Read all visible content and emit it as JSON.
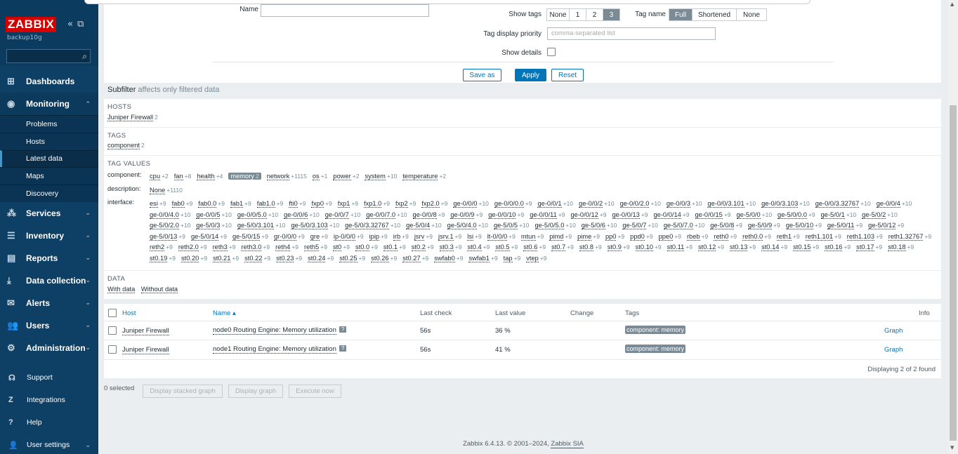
{
  "app": {
    "logo": "ZABBIX",
    "server": "backup10g"
  },
  "sidebar": {
    "menu": [
      {
        "label": "Dashboards",
        "icon": "dashboard-icon"
      },
      {
        "label": "Monitoring",
        "icon": "eye-icon",
        "open": true
      },
      {
        "label": "Services",
        "icon": "services-icon"
      },
      {
        "label": "Inventory",
        "icon": "list-icon"
      },
      {
        "label": "Reports",
        "icon": "report-icon"
      },
      {
        "label": "Data collection",
        "icon": "download-icon"
      },
      {
        "label": "Alerts",
        "icon": "mail-icon"
      },
      {
        "label": "Users",
        "icon": "users-icon"
      },
      {
        "label": "Administration",
        "icon": "gear-icon"
      }
    ],
    "monitoring_sub": [
      "Problems",
      "Hosts",
      "Latest data",
      "Maps",
      "Discovery"
    ],
    "bottom": [
      {
        "label": "Support",
        "icon": "support-icon"
      },
      {
        "label": "Integrations",
        "icon": "integrations-icon"
      },
      {
        "label": "Help",
        "icon": "help-icon"
      },
      {
        "label": "User settings",
        "icon": "user-icon"
      }
    ]
  },
  "filter": {
    "name_label": "Name",
    "show_tags_label": "Show tags",
    "show_tags_options": [
      "None",
      "1",
      "2",
      "3"
    ],
    "tag_name_label": "Tag name",
    "tag_name_options": [
      "Full",
      "Shortened",
      "None"
    ],
    "tag_priority_label": "Tag display priority",
    "tag_priority_placeholder": "comma-separated list",
    "show_details_label": "Show details",
    "save_as": "Save as",
    "apply": "Apply",
    "reset": "Reset"
  },
  "subfilter": {
    "title": "Subfilter",
    "note": "affects only filtered data",
    "hosts_header": "HOSTS",
    "hosts": [
      {
        "name": "Juniper Firewall",
        "count": "2"
      }
    ],
    "tags_header": "TAGS",
    "tags": [
      {
        "name": "component",
        "count": "2"
      }
    ],
    "tag_values_header": "TAG VALUES",
    "component_label": "component:",
    "component": [
      [
        "cpu",
        "+2"
      ],
      [
        "fan",
        "+8"
      ],
      [
        "health",
        "+4"
      ],
      [
        "memory",
        "2"
      ],
      [
        "network",
        "+1115"
      ],
      [
        "os",
        "+1"
      ],
      [
        "power",
        "+2"
      ],
      [
        "system",
        "+10"
      ],
      [
        "temperature",
        "+2"
      ]
    ],
    "description_label": "description:",
    "description": [
      [
        "None",
        "+1110"
      ]
    ],
    "interface_label": "interface:",
    "interface": [
      [
        "esi",
        "+9"
      ],
      [
        "fab0",
        "+9"
      ],
      [
        "fab0.0",
        "+9"
      ],
      [
        "fab1",
        "+9"
      ],
      [
        "fab1.0",
        "+9"
      ],
      [
        "fti0",
        "+9"
      ],
      [
        "fxp0",
        "+9"
      ],
      [
        "fxp1",
        "+9"
      ],
      [
        "fxp1.0",
        "+9"
      ],
      [
        "fxp2",
        "+9"
      ],
      [
        "fxp2.0",
        "+9"
      ],
      [
        "ge-0/0/0",
        "+10"
      ],
      [
        "ge-0/0/0.0",
        "+9"
      ],
      [
        "ge-0/0/1",
        "+10"
      ],
      [
        "ge-0/0/2",
        "+10"
      ],
      [
        "ge-0/0/2.0",
        "+10"
      ],
      [
        "ge-0/0/3",
        "+10"
      ],
      [
        "ge-0/0/3.101",
        "+10"
      ],
      [
        "ge-0/0/3.103",
        "+10"
      ],
      [
        "ge-0/0/3.32767",
        "+10"
      ],
      [
        "ge-0/0/4",
        "+10"
      ],
      [
        "ge-0/0/4.0",
        "+10"
      ],
      [
        "ge-0/0/5",
        "+10"
      ],
      [
        "ge-0/0/5.0",
        "+10"
      ],
      [
        "ge-0/0/6",
        "+10"
      ],
      [
        "ge-0/0/7",
        "+10"
      ],
      [
        "ge-0/0/7.0",
        "+10"
      ],
      [
        "ge-0/0/8",
        "+9"
      ],
      [
        "ge-0/0/9",
        "+9"
      ],
      [
        "ge-0/0/10",
        "+9"
      ],
      [
        "ge-0/0/11",
        "+9"
      ],
      [
        "ge-0/0/12",
        "+9"
      ],
      [
        "ge-0/0/13",
        "+9"
      ],
      [
        "ge-0/0/14",
        "+9"
      ],
      [
        "ge-0/0/15",
        "+9"
      ],
      [
        "ge-5/0/0",
        "+10"
      ],
      [
        "ge-5/0/0.0",
        "+9"
      ],
      [
        "ge-5/0/1",
        "+10"
      ],
      [
        "ge-5/0/2",
        "+10"
      ],
      [
        "ge-5/0/2.0",
        "+10"
      ],
      [
        "ge-5/0/3",
        "+10"
      ],
      [
        "ge-5/0/3.101",
        "+10"
      ],
      [
        "ge-5/0/3.103",
        "+10"
      ],
      [
        "ge-5/0/3.32767",
        "+10"
      ],
      [
        "ge-5/0/4",
        "+10"
      ],
      [
        "ge-5/0/4.0",
        "+10"
      ],
      [
        "ge-5/0/5",
        "+10"
      ],
      [
        "ge-5/0/5.0",
        "+10"
      ],
      [
        "ge-5/0/6",
        "+10"
      ],
      [
        "ge-5/0/7",
        "+10"
      ],
      [
        "ge-5/0/7.0",
        "+10"
      ],
      [
        "ge-5/0/8",
        "+9"
      ],
      [
        "ge-5/0/9",
        "+9"
      ],
      [
        "ge-5/0/10",
        "+9"
      ],
      [
        "ge-5/0/11",
        "+9"
      ],
      [
        "ge-5/0/12",
        "+9"
      ],
      [
        "ge-5/0/13",
        "+9"
      ],
      [
        "ge-5/0/14",
        "+9"
      ],
      [
        "ge-5/0/15",
        "+9"
      ],
      [
        "gr-0/0/0",
        "+9"
      ],
      [
        "gre",
        "+9"
      ],
      [
        "ip-0/0/0",
        "+9"
      ],
      [
        "ipip",
        "+9"
      ],
      [
        "irb",
        "+9"
      ],
      [
        "jsrv",
        "+9"
      ],
      [
        "jsrv.1",
        "+9"
      ],
      [
        "lsi",
        "+9"
      ],
      [
        "lt-0/0/0",
        "+9"
      ],
      [
        "mtun",
        "+9"
      ],
      [
        "pimd",
        "+9"
      ],
      [
        "pime",
        "+9"
      ],
      [
        "pp0",
        "+9"
      ],
      [
        "ppd0",
        "+9"
      ],
      [
        "ppe0",
        "+9"
      ],
      [
        "rbeb",
        "+9"
      ],
      [
        "reth0",
        "+9"
      ],
      [
        "reth0.0",
        "+9"
      ],
      [
        "reth1",
        "+9"
      ],
      [
        "reth1.101",
        "+9"
      ],
      [
        "reth1.103",
        "+9"
      ],
      [
        "reth1.32767",
        "+9"
      ],
      [
        "reth2",
        "+9"
      ],
      [
        "reth2.0",
        "+9"
      ],
      [
        "reth3",
        "+9"
      ],
      [
        "reth3.0",
        "+9"
      ],
      [
        "reth4",
        "+9"
      ],
      [
        "reth5",
        "+9"
      ],
      [
        "st0",
        "+9"
      ],
      [
        "st0.0",
        "+9"
      ],
      [
        "st0.1",
        "+9"
      ],
      [
        "st0.2",
        "+9"
      ],
      [
        "st0.3",
        "+9"
      ],
      [
        "st0.4",
        "+9"
      ],
      [
        "st0.5",
        "+9"
      ],
      [
        "st0.6",
        "+9"
      ],
      [
        "st0.7",
        "+9"
      ],
      [
        "st0.8",
        "+9"
      ],
      [
        "st0.9",
        "+9"
      ],
      [
        "st0.10",
        "+9"
      ],
      [
        "st0.11",
        "+9"
      ],
      [
        "st0.12",
        "+9"
      ],
      [
        "st0.13",
        "+9"
      ],
      [
        "st0.14",
        "+9"
      ],
      [
        "st0.15",
        "+9"
      ],
      [
        "st0.16",
        "+9"
      ],
      [
        "st0.17",
        "+9"
      ],
      [
        "st0.18",
        "+9"
      ],
      [
        "st0.19",
        "+9"
      ],
      [
        "st0.20",
        "+9"
      ],
      [
        "st0.21",
        "+9"
      ],
      [
        "st0.22",
        "+9"
      ],
      [
        "st0.23",
        "+9"
      ],
      [
        "st0.24",
        "+9"
      ],
      [
        "st0.25",
        "+9"
      ],
      [
        "st0.26",
        "+9"
      ],
      [
        "st0.27",
        "+9"
      ],
      [
        "swfab0",
        "+9"
      ],
      [
        "swfab1",
        "+9"
      ],
      [
        "tap",
        "+9"
      ],
      [
        "vtep",
        "+9"
      ]
    ],
    "data_header": "DATA",
    "data": [
      "With data",
      "Without data"
    ]
  },
  "table": {
    "headers": {
      "host": "Host",
      "name": "Name ▴",
      "last_check": "Last check",
      "last_value": "Last value",
      "change": "Change",
      "tags": "Tags",
      "info": "Info"
    },
    "rows": [
      {
        "host": "Juniper Firewall",
        "name": "node0 Routing Engine: Memory utilization",
        "badge": "?",
        "last_check": "56s",
        "last_value": "36 %",
        "change": "",
        "tag": "component: memory",
        "action": "Graph"
      },
      {
        "host": "Juniper Firewall",
        "name": "node1 Routing Engine: Memory utilization",
        "badge": "?",
        "last_check": "56s",
        "last_value": "41 %",
        "change": "",
        "tag": "component: memory",
        "action": "Graph"
      }
    ],
    "found": "Displaying 2 of 2 found"
  },
  "actions": {
    "selected": "0 selected",
    "display_stacked": "Display stacked graph",
    "display_graph": "Display graph",
    "execute_now": "Execute now"
  },
  "footer": {
    "version": "Zabbix 6.4.13. © 2001–2024,",
    "company": "Zabbix SIA"
  }
}
